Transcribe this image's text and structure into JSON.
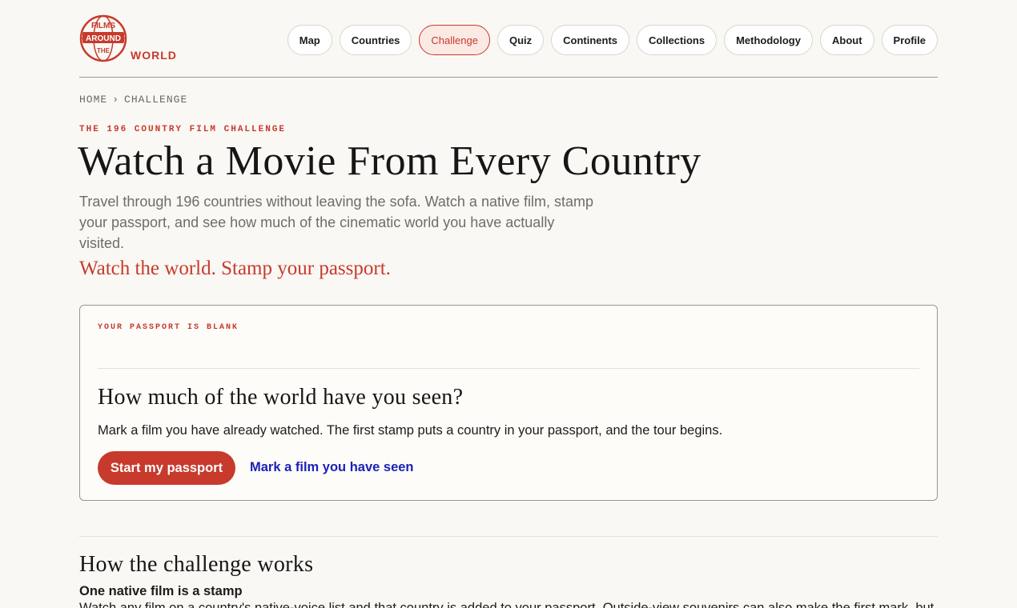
{
  "brand": {
    "logo_top": "FILMS",
    "logo_mid": "AROUND",
    "logo_low": "THE",
    "logo_word": "WORLD",
    "accent_color": "#c73a2c",
    "link_color": "#1a22b8"
  },
  "nav": {
    "items": [
      {
        "label": "Map"
      },
      {
        "label": "Countries"
      },
      {
        "label": "Challenge",
        "active": true
      },
      {
        "label": "Quiz"
      },
      {
        "label": "Continents"
      },
      {
        "label": "Collections"
      },
      {
        "label": "Methodology"
      },
      {
        "label": "About"
      },
      {
        "label": "Profile"
      }
    ]
  },
  "breadcrumb": {
    "home": "HOME",
    "separator": "›",
    "current": "CHALLENGE"
  },
  "hero": {
    "eyebrow": "THE 196 COUNTRY FILM CHALLENGE",
    "title": "Watch a Movie From Every Country",
    "description": "Travel through 196 countries without leaving the sofa. Watch a native film, stamp your passport, and see how much of the cinematic world you have actually visited.",
    "tagline": "Watch the world. Stamp your passport."
  },
  "passport_card": {
    "status": "YOUR PASSPORT IS BLANK",
    "title": "How much of the world have you seen?",
    "text": "Mark a film you have already watched. The first stamp puts a country in your passport, and the tour begins.",
    "primary_button": "Start my passport",
    "secondary_link": "Mark a film you have seen"
  },
  "how_it_works": {
    "title": "How the challenge works",
    "step_title": "One native film is a stamp",
    "step_text": "Watch any film on a country's native-voice list and that country is added to your passport. Outside-view souvenirs can also make the first mark, but"
  }
}
